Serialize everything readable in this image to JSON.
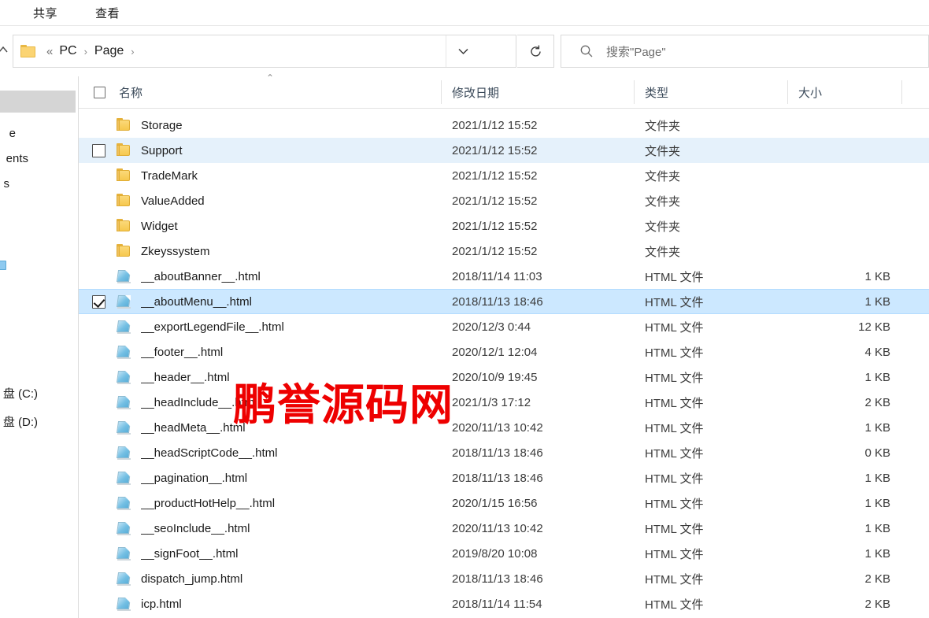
{
  "ribbon": {
    "tabs": [
      {
        "label": "共享"
      },
      {
        "label": "查看"
      }
    ]
  },
  "navbar": {
    "up_arrow_icon": "arrow-up-icon",
    "folder_icon": "folder-icon",
    "breadcrumb": {
      "overflow": "«",
      "items": [
        "PC",
        "Page"
      ],
      "separator": "›"
    },
    "history_chevron_icon": "chevron-down-icon",
    "refresh_icon": "refresh-icon",
    "search": {
      "icon": "search-icon",
      "placeholder": "搜索\"Page\""
    }
  },
  "columns": {
    "sort_indicator": "⌃",
    "name": "名称",
    "date": "修改日期",
    "type": "类型",
    "size": "大小"
  },
  "sidebar": {
    "items": [
      {
        "label": "e"
      },
      {
        "label": "ents"
      },
      {
        "label": "s"
      },
      {
        "label": ""
      },
      {
        "label": "盘 (C:)"
      },
      {
        "label": "盘 (D:)"
      }
    ]
  },
  "colors": {
    "hover_row": "#e5f1fb",
    "selected_row": "#cce8ff",
    "watermark": "#ee0000",
    "header_text": "#3b4a5a"
  },
  "watermark": {
    "text": "鹏誉源码网"
  },
  "files": [
    {
      "name": "Storage",
      "date": "2021/1/12 15:52",
      "type": "文件夹",
      "size": "",
      "icon": "folder-icon",
      "state": "normal",
      "checkbox": "none"
    },
    {
      "name": "Support",
      "date": "2021/1/12 15:52",
      "type": "文件夹",
      "size": "",
      "icon": "folder-icon",
      "state": "hover",
      "checkbox": "unchecked"
    },
    {
      "name": "TradeMark",
      "date": "2021/1/12 15:52",
      "type": "文件夹",
      "size": "",
      "icon": "folder-icon",
      "state": "normal",
      "checkbox": "none"
    },
    {
      "name": "ValueAdded",
      "date": "2021/1/12 15:52",
      "type": "文件夹",
      "size": "",
      "icon": "folder-icon",
      "state": "normal",
      "checkbox": "none"
    },
    {
      "name": "Widget",
      "date": "2021/1/12 15:52",
      "type": "文件夹",
      "size": "",
      "icon": "folder-icon",
      "state": "normal",
      "checkbox": "none"
    },
    {
      "name": "Zkeyssystem",
      "date": "2021/1/12 15:52",
      "type": "文件夹",
      "size": "",
      "icon": "folder-icon",
      "state": "normal",
      "checkbox": "none"
    },
    {
      "name": "__aboutBanner__.html",
      "date": "2018/11/14 11:03",
      "type": "HTML 文件",
      "size": "1 KB",
      "icon": "html-file-icon",
      "state": "normal",
      "checkbox": "none"
    },
    {
      "name": "__aboutMenu__.html",
      "date": "2018/11/13 18:46",
      "type": "HTML 文件",
      "size": "1 KB",
      "icon": "html-file-icon",
      "state": "selected",
      "checkbox": "checked"
    },
    {
      "name": "__exportLegendFile__.html",
      "date": "2020/12/3 0:44",
      "type": "HTML 文件",
      "size": "12 KB",
      "icon": "html-file-icon",
      "state": "normal",
      "checkbox": "none"
    },
    {
      "name": "__footer__.html",
      "date": "2020/12/1 12:04",
      "type": "HTML 文件",
      "size": "4 KB",
      "icon": "html-file-icon",
      "state": "normal",
      "checkbox": "none"
    },
    {
      "name": "__header__.html",
      "date": "2020/10/9 19:45",
      "type": "HTML 文件",
      "size": "1 KB",
      "icon": "html-file-icon",
      "state": "normal",
      "checkbox": "none"
    },
    {
      "name": "__headInclude__.html",
      "date": "2021/1/3 17:12",
      "type": "HTML 文件",
      "size": "2 KB",
      "icon": "html-file-icon",
      "state": "normal",
      "checkbox": "none"
    },
    {
      "name": "__headMeta__.html",
      "date": "2020/11/13 10:42",
      "type": "HTML 文件",
      "size": "1 KB",
      "icon": "html-file-icon",
      "state": "normal",
      "checkbox": "none"
    },
    {
      "name": "__headScriptCode__.html",
      "date": "2018/11/13 18:46",
      "type": "HTML 文件",
      "size": "0 KB",
      "icon": "html-file-icon",
      "state": "normal",
      "checkbox": "none"
    },
    {
      "name": "__pagination__.html",
      "date": "2018/11/13 18:46",
      "type": "HTML 文件",
      "size": "1 KB",
      "icon": "html-file-icon",
      "state": "normal",
      "checkbox": "none"
    },
    {
      "name": "__productHotHelp__.html",
      "date": "2020/1/15 16:56",
      "type": "HTML 文件",
      "size": "1 KB",
      "icon": "html-file-icon",
      "state": "normal",
      "checkbox": "none"
    },
    {
      "name": "__seoInclude__.html",
      "date": "2020/11/13 10:42",
      "type": "HTML 文件",
      "size": "1 KB",
      "icon": "html-file-icon",
      "state": "normal",
      "checkbox": "none"
    },
    {
      "name": "__signFoot__.html",
      "date": "2019/8/20 10:08",
      "type": "HTML 文件",
      "size": "1 KB",
      "icon": "html-file-icon",
      "state": "normal",
      "checkbox": "none"
    },
    {
      "name": "dispatch_jump.html",
      "date": "2018/11/13 18:46",
      "type": "HTML 文件",
      "size": "2 KB",
      "icon": "html-file-icon",
      "state": "normal",
      "checkbox": "none"
    },
    {
      "name": "icp.html",
      "date": "2018/11/14 11:54",
      "type": "HTML 文件",
      "size": "2 KB",
      "icon": "html-file-icon",
      "state": "normal",
      "checkbox": "none"
    }
  ]
}
